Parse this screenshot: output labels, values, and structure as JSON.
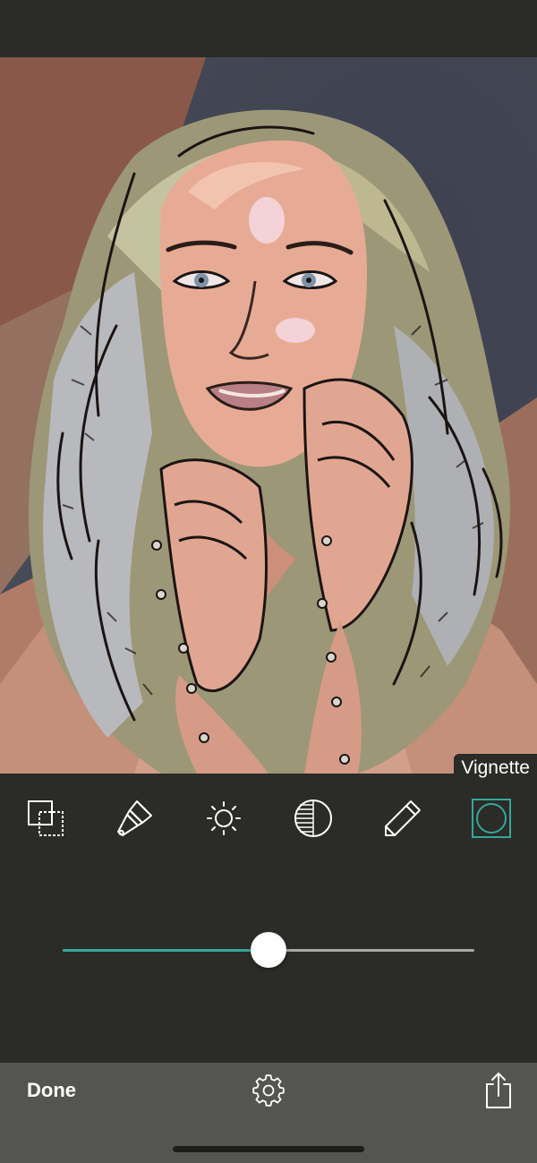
{
  "editor": {
    "tooltip": "Vignette",
    "active_tool": "vignette",
    "accent_color": "#34a89a",
    "tools": [
      {
        "id": "layers",
        "icon": "layers-icon"
      },
      {
        "id": "brush",
        "icon": "paint-brush-icon"
      },
      {
        "id": "brightness",
        "icon": "sun-icon"
      },
      {
        "id": "contrast",
        "icon": "contrast-icon"
      },
      {
        "id": "pencil",
        "icon": "pencil-icon"
      },
      {
        "id": "vignette",
        "icon": "vignette-icon"
      }
    ],
    "slider": {
      "value": 0.5
    }
  },
  "bottom_bar": {
    "done_label": "Done",
    "settings_icon": "gear-icon",
    "share_icon": "share-icon"
  }
}
